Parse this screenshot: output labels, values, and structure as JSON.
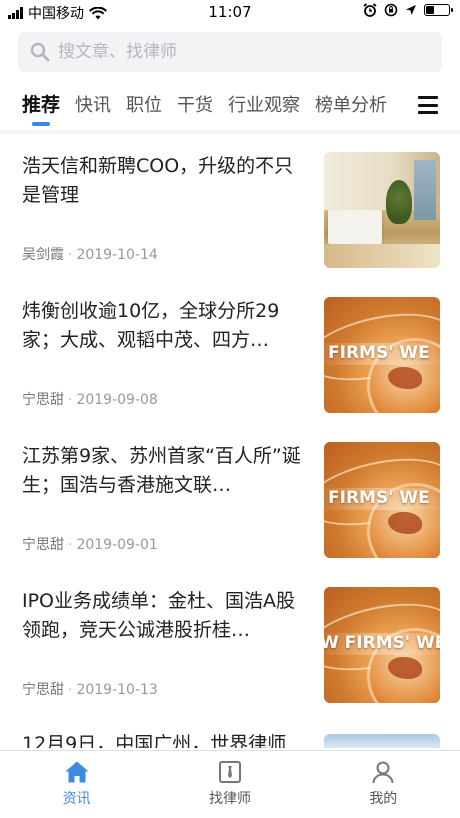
{
  "status_bar": {
    "carrier": "中国移动",
    "time": "11:07"
  },
  "search": {
    "placeholder": "搜文章、找律师"
  },
  "tabs": [
    {
      "label": "推荐",
      "active": true
    },
    {
      "label": "快讯",
      "active": false
    },
    {
      "label": "职位",
      "active": false
    },
    {
      "label": "干货",
      "active": false
    },
    {
      "label": "行业观察",
      "active": false
    },
    {
      "label": "榜单分析",
      "active": false
    }
  ],
  "articles": [
    {
      "title": "浩天信和新聘COO，升级的不只是管理",
      "author": "吴剑霞",
      "date": "2019-10-14",
      "thumb": "office"
    },
    {
      "title": "炜衡创收逾10亿，全球分所29家；大成、观韬中茂、四方…",
      "author": "宁思甜",
      "date": "2019-09-08",
      "thumb": "globe",
      "thumb_text": "FIRMS' WE"
    },
    {
      "title": "江苏第9家、苏州首家“百人所”诞生；国浩与香港施文联…",
      "author": "宁思甜",
      "date": "2019-09-01",
      "thumb": "globe",
      "thumb_text": "FIRMS' WE"
    },
    {
      "title": "IPO业务成绩单：金杜、国浩A股领跑，竞天公诚港股折桂…",
      "author": "宁思甜",
      "date": "2019-10-13",
      "thumb": "globe",
      "thumb_text": "W FIRMS' WEE"
    },
    {
      "title": "12月9日，中国广州，世界律师",
      "thumb": "sky"
    }
  ],
  "tabbar": [
    {
      "label": "资讯",
      "icon": "home-icon",
      "active": true
    },
    {
      "label": "找律师",
      "icon": "lawyer-icon",
      "active": false
    },
    {
      "label": "我的",
      "icon": "profile-icon",
      "active": false
    }
  ],
  "colors": {
    "accent": "#3c8be0",
    "search_bg": "#f2f3f5"
  }
}
